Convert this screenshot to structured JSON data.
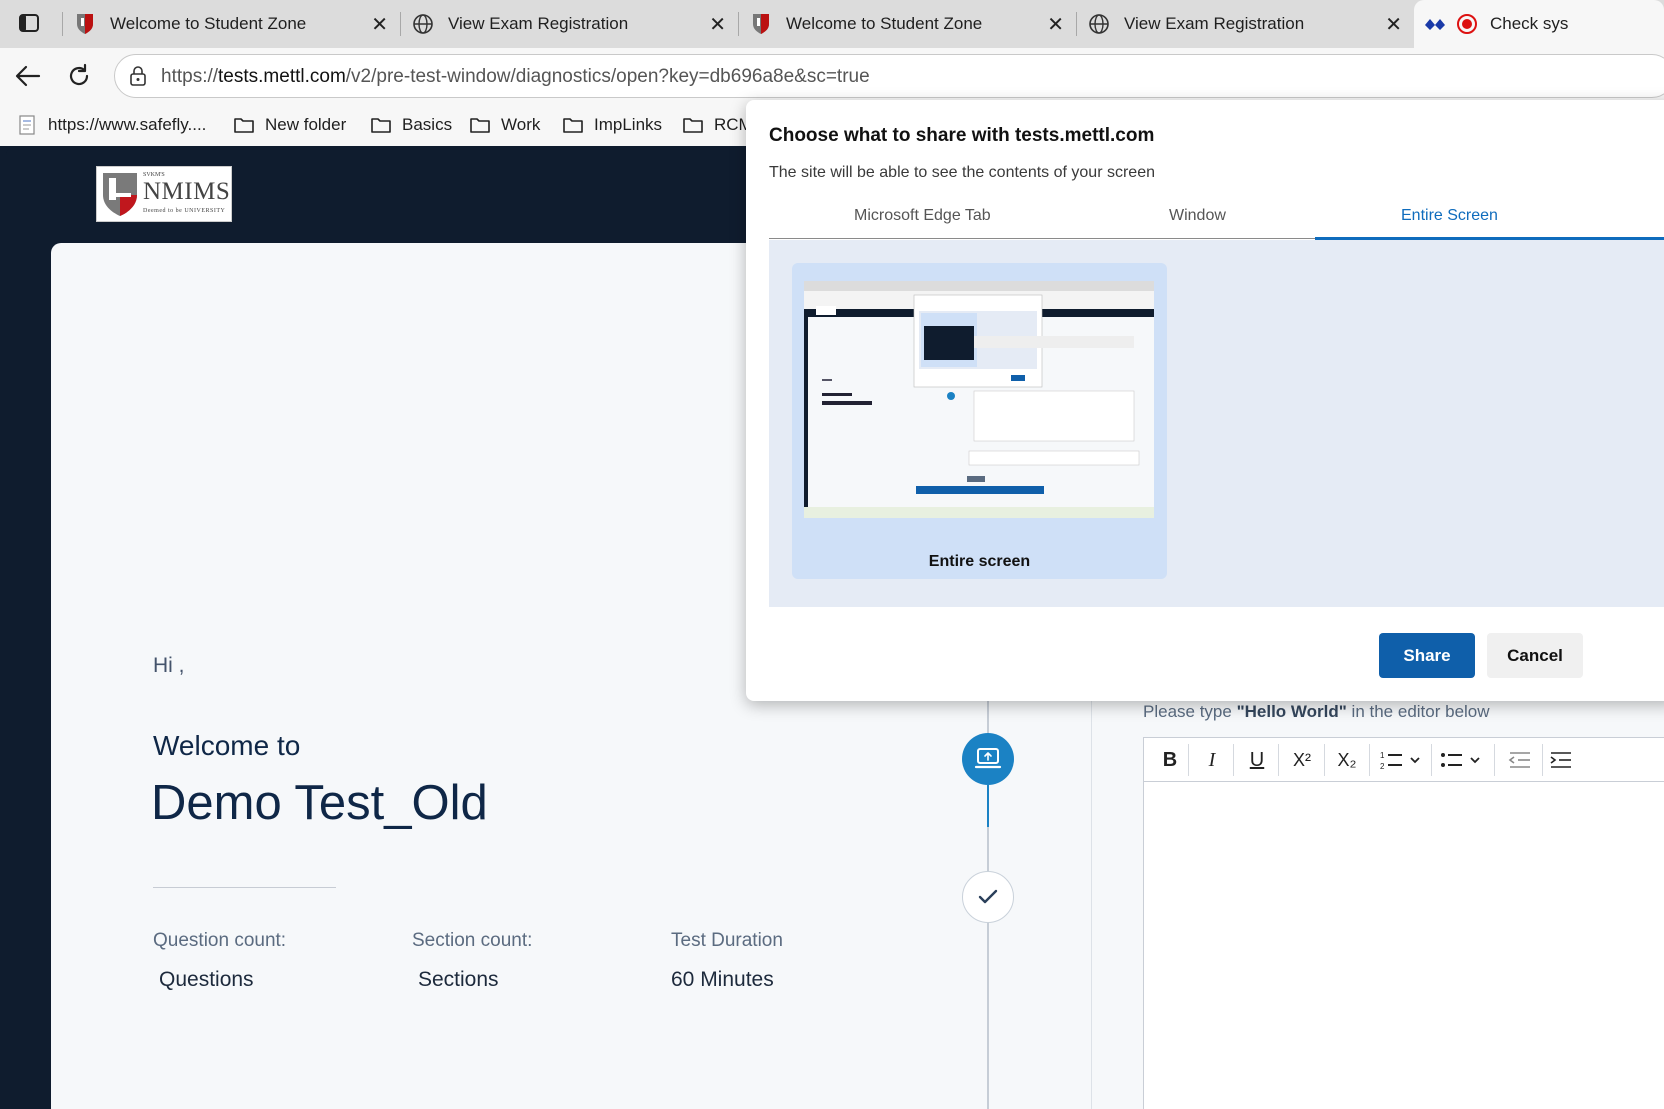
{
  "browser": {
    "tabs": [
      {
        "title": "Welcome to Student Zone",
        "icon": "nmims-shield-icon"
      },
      {
        "title": "View Exam Registration",
        "icon": "globe-icon"
      },
      {
        "title": "Welcome to Student Zone",
        "icon": "nmims-shield-icon"
      },
      {
        "title": "View Exam Registration",
        "icon": "globe-icon"
      },
      {
        "title": "Check sys",
        "icon": "mettl-icon"
      }
    ],
    "url": {
      "scheme": "https://",
      "host": "tests.mettl.com",
      "path": "/v2/pre-test-window/diagnostics/open?key=db696a8e&sc=true"
    },
    "bookmarks": [
      "https://www.safefly....",
      "New folder",
      "Basics",
      "Work",
      "ImpLinks",
      "RCM"
    ]
  },
  "logo": {
    "small": "SVKM'S",
    "name": "NMIMS",
    "sub": "Deemed to be UNIVERSITY"
  },
  "page": {
    "greeting": "Hi ,",
    "welcome": "Welcome to",
    "test_name": "Demo Test_Old",
    "stats": [
      {
        "label": "Question count:",
        "value": "Questions"
      },
      {
        "label": "Section count:",
        "value": "Sections"
      },
      {
        "label": "Test Duration",
        "value": "60  Minutes"
      }
    ],
    "instruction": {
      "prefix": "Please type ",
      "bold": "\"Hello World\"",
      "suffix": " in the editor below"
    },
    "editor_tools": [
      "B",
      "I",
      "U",
      "X²",
      "X₂"
    ]
  },
  "dialog": {
    "title": "Choose what to share with tests.mettl.com",
    "subtitle": "The site will be able to see the contents of your screen",
    "tabs": [
      "Microsoft Edge Tab",
      "Window",
      "Entire Screen"
    ],
    "selected_tab": "Entire Screen",
    "tile_label": "Entire screen",
    "share": "Share",
    "cancel": "Cancel"
  },
  "colors": {
    "accent": "#0f6cbd",
    "step_active": "#1b82c4",
    "page_dark": "#0f1c2e"
  }
}
